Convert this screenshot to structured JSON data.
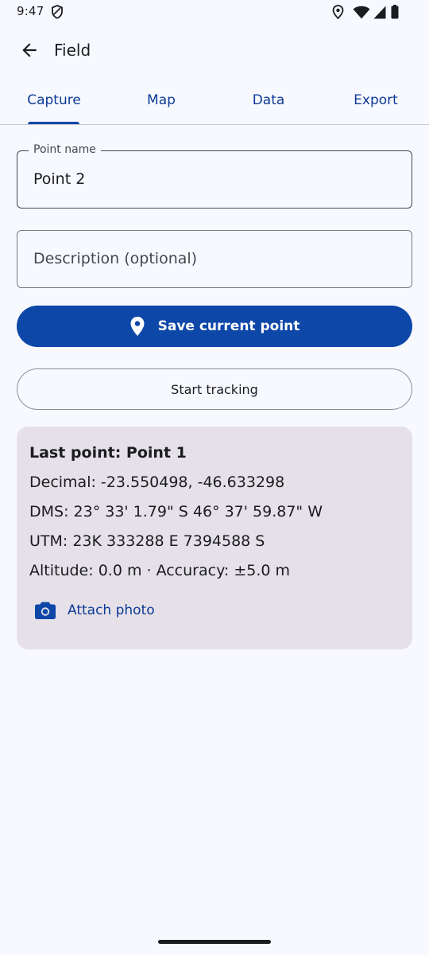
{
  "status_bar": {
    "time": "9:47",
    "icons": [
      "shield-icon",
      "location-icon",
      "wifi-icon",
      "signal-icon",
      "battery-icon"
    ]
  },
  "app_bar": {
    "title": "Field",
    "back_icon": "arrow-back-icon"
  },
  "tabs": [
    {
      "label": "Capture",
      "selected": true
    },
    {
      "label": "Map",
      "selected": false
    },
    {
      "label": "Data",
      "selected": false
    },
    {
      "label": "Export",
      "selected": false
    }
  ],
  "form": {
    "point_name": {
      "label": "Point name",
      "value": "Point 2"
    },
    "description": {
      "placeholder": "Description (optional)",
      "value": ""
    }
  },
  "actions": {
    "save_label": "Save current point",
    "save_icon": "location-pin-icon",
    "tracking_label": "Start tracking"
  },
  "last_point": {
    "title": "Last point: Point 1",
    "decimal": "Decimal: -23.550498, -46.633298",
    "dms": "DMS: 23° 33' 1.79\" S 46° 37' 59.87\" W",
    "utm": "UTM: 23K 333288 E 7394588 S",
    "altitude_accuracy": "Altitude: 0.0 m · Accuracy: ±5.0 m",
    "attach_label": "Attach photo",
    "attach_icon": "camera-icon"
  },
  "colors": {
    "primary": "#0d47a8",
    "tab_text": "#0d3a97",
    "background": "#f8f9ff",
    "card_background": "#e6e1e8"
  }
}
